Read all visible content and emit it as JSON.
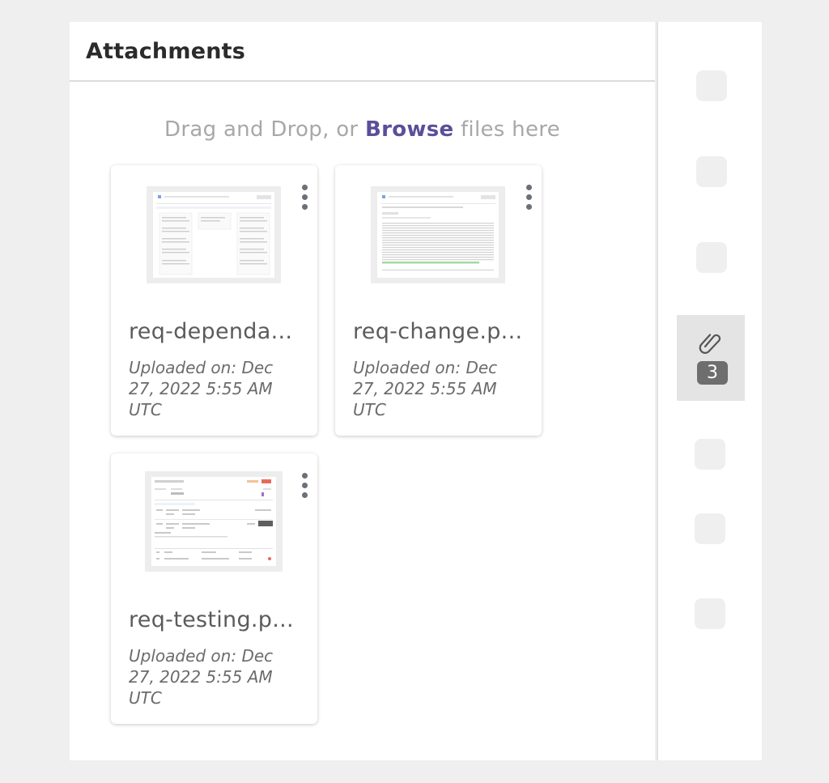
{
  "panel": {
    "title": "Attachments"
  },
  "dropzone": {
    "prefix": "Drag and Drop, or ",
    "browse_label": "Browse",
    "suffix": " files here"
  },
  "attachments": [
    {
      "name": "req-dependa...",
      "uploaded": "Uploaded on: Dec 27, 2022 5:55 AM UTC"
    },
    {
      "name": "req-change.p...",
      "uploaded": "Uploaded on: Dec 27, 2022 5:55 AM UTC"
    },
    {
      "name": "req-testing.p...",
      "uploaded": "Uploaded on: Dec 27, 2022 5:55 AM UTC"
    }
  ],
  "rail": {
    "active_icon": "paperclip-icon",
    "attachment_count": "3"
  },
  "colors": {
    "browse_link": "#5a4f9a",
    "badge": "#6e6e6e",
    "background": "#efefef"
  }
}
